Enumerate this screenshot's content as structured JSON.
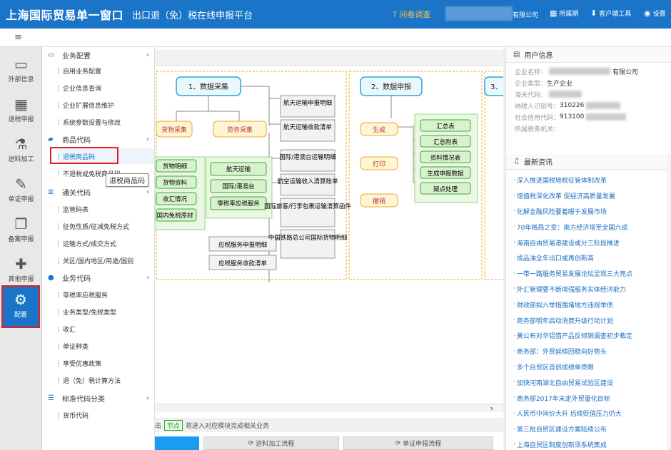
{
  "header": {
    "title": "上海国际贸易单一窗口",
    "subtitle": "出口退（免）税在线申报平台",
    "survey": "问卷调查",
    "company_suffix": "有限公司",
    "period": "所属期",
    "client_tool": "客户端工具",
    "settings": "设置"
  },
  "leftnav": [
    {
      "label": "外部信息",
      "icon": "drive-icon"
    },
    {
      "label": "退税申报",
      "icon": "boxes-icon"
    },
    {
      "label": "进料加工",
      "icon": "flask-icon"
    },
    {
      "label": "单证申报",
      "icon": "edit-icon"
    },
    {
      "label": "备案申报",
      "icon": "copy-icon"
    },
    {
      "label": "其他申报",
      "icon": "puzzle-icon"
    },
    {
      "label": "配置",
      "icon": "gears-icon"
    }
  ],
  "tree": {
    "groups": [
      {
        "label": "业务配置",
        "items": [
          "自用业务配置",
          "企业信息查询",
          "企业扩展信息维护",
          "系统参数设置与修改"
        ]
      },
      {
        "label": "商品代码",
        "items": [
          "退税商品码",
          "不退税或免税商品码"
        ]
      },
      {
        "label": "通关代码",
        "items": [
          "监管码表",
          "征免性质/征减免税方式",
          "运输方式/成交方式",
          "关区/国内地区/用途/国别"
        ]
      },
      {
        "label": "业务代码",
        "items": [
          "零税率应税服务",
          "业务类型/免税类型",
          "收汇",
          "单证种类",
          "享受优惠政策",
          "退（免）税计算方法"
        ]
      },
      {
        "label": "标准代码分类",
        "items": [
          "货币代码"
        ]
      }
    ],
    "tooltip": "退税商品码"
  },
  "flow": {
    "stage1": "1、数据采集",
    "stage2": "2、数据申报",
    "stage3": "3、",
    "goods": "货物采集",
    "service": "劳务采集",
    "goods_items": [
      "货物明细",
      "货物资料",
      "收汇情况",
      "国内免税原材"
    ],
    "service_items": [
      "航天运输",
      "国际/港澳台",
      "零税率应税服务"
    ],
    "service_extra": [
      "应税服务申报明细",
      "应税服务收款清单"
    ],
    "right_boxes": [
      "航天运输申报明细",
      "航天运输收款清单",
      "国际/港澳台运输明细",
      "航空运输收入清算账单",
      "国际旅客/行李包裹运输清算函件",
      "中国铁路总公司国际货物明细"
    ],
    "declare": [
      "生成",
      "打印",
      "撤销"
    ],
    "gen_items": [
      "汇总表",
      "汇总附表",
      "资料情况表",
      "生成申报数据",
      "疑点处理"
    ]
  },
  "tipbar": {
    "prefix": "击",
    "node": "节点",
    "text": "将进入对应模块完成相关业务"
  },
  "buttons": [
    "进料加工流程",
    "单证申报流程"
  ],
  "user_info": {
    "title": "用户信息",
    "rows": [
      {
        "label": "企业名称：",
        "value": "有限公司"
      },
      {
        "label": "企业类型：",
        "value": "生产企业"
      },
      {
        "label": "海关代码：",
        "value": ""
      },
      {
        "label": "纳税人识别号：",
        "value": "310226"
      },
      {
        "label": "社会信用代码：",
        "value": "913100"
      },
      {
        "label": "所属税务机关：",
        "value": ""
      }
    ]
  },
  "news": {
    "title": "最新资讯",
    "items": [
      "深入推进国税地税征管体制改革",
      "增值税深化改革 促经济高质量发展",
      "化解金融风险要着眼于发展市场",
      "70年格局之变：南方经济增至全国六成",
      "海南自由贸易港建设或分三阶段推进",
      "成品油全年出口或再创新高",
      "一带一路服务贸易发展论坛显现三大亮点",
      "外汇管理要不断增强服务实体经济能力",
      "财政部拟六举措围堵地方违规举债",
      "商务部明年启动消费升级行动计划",
      "美公布对华铝箔产品反倾销调查初步裁定",
      "商务部：外贸延续回稳向好势头",
      "多个自贸区首创成绩单亮眼",
      "加快河南湖北自由贸易试验区建设",
      "商务部2017年末定外贸量化目标",
      "人民币中间价大升 后续贬值压力仍大",
      "第三批自贸区建设方案陆续公布",
      "上海自贸区制度创新须系统集成"
    ]
  },
  "colors": {
    "brand": "#1a75c9",
    "highlight": "#e02020",
    "flow_green": "#3aaa3a",
    "flow_orange": "#f5a623"
  }
}
